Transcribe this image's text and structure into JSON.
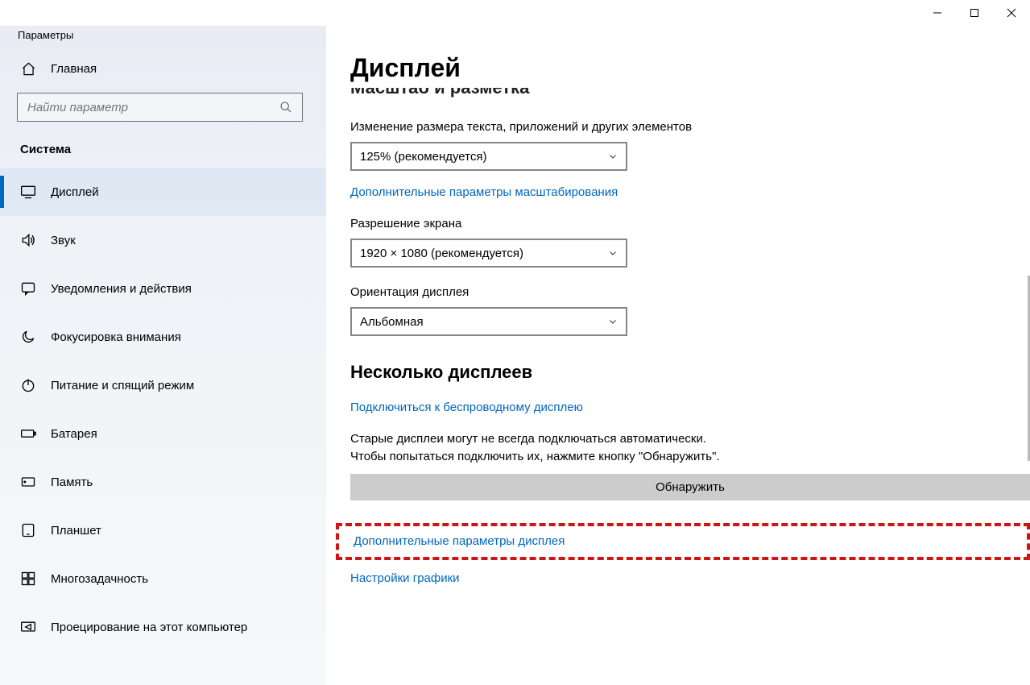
{
  "window": {
    "title": "Параметры"
  },
  "sidebar": {
    "home": "Главная",
    "search_placeholder": "Найти параметр",
    "category": "Система",
    "items": [
      {
        "label": "Дисплей"
      },
      {
        "label": "Звук"
      },
      {
        "label": "Уведомления и действия"
      },
      {
        "label": "Фокусировка внимания"
      },
      {
        "label": "Питание и спящий режим"
      },
      {
        "label": "Батарея"
      },
      {
        "label": "Память"
      },
      {
        "label": "Планшет"
      },
      {
        "label": "Многозадачность"
      },
      {
        "label": "Проецирование на этот компьютер"
      }
    ]
  },
  "main": {
    "page_title": "Дисплей",
    "section_scale": "Масштаб и разметка",
    "scale_label": "Изменение размера текста, приложений и других элементов",
    "scale_value": "125% (рекомендуется)",
    "advanced_scale_link": "Дополнительные параметры масштабирования",
    "resolution_label": "Разрешение экрана",
    "resolution_value": "1920 × 1080 (рекомендуется)",
    "orientation_label": "Ориентация дисплея",
    "orientation_value": "Альбомная",
    "multi_heading": "Несколько дисплеев",
    "wireless_link": "Подключиться к беспроводному дисплею",
    "detect_para1": "Старые дисплеи могут не всегда подключаться автоматически.",
    "detect_para2": "Чтобы попытаться подключить их, нажмите кнопку \"Обнаружить\".",
    "detect_btn": "Обнаружить",
    "advanced_display_link": "Дополнительные параметры дисплея",
    "graphics_link": "Настройки графики"
  }
}
